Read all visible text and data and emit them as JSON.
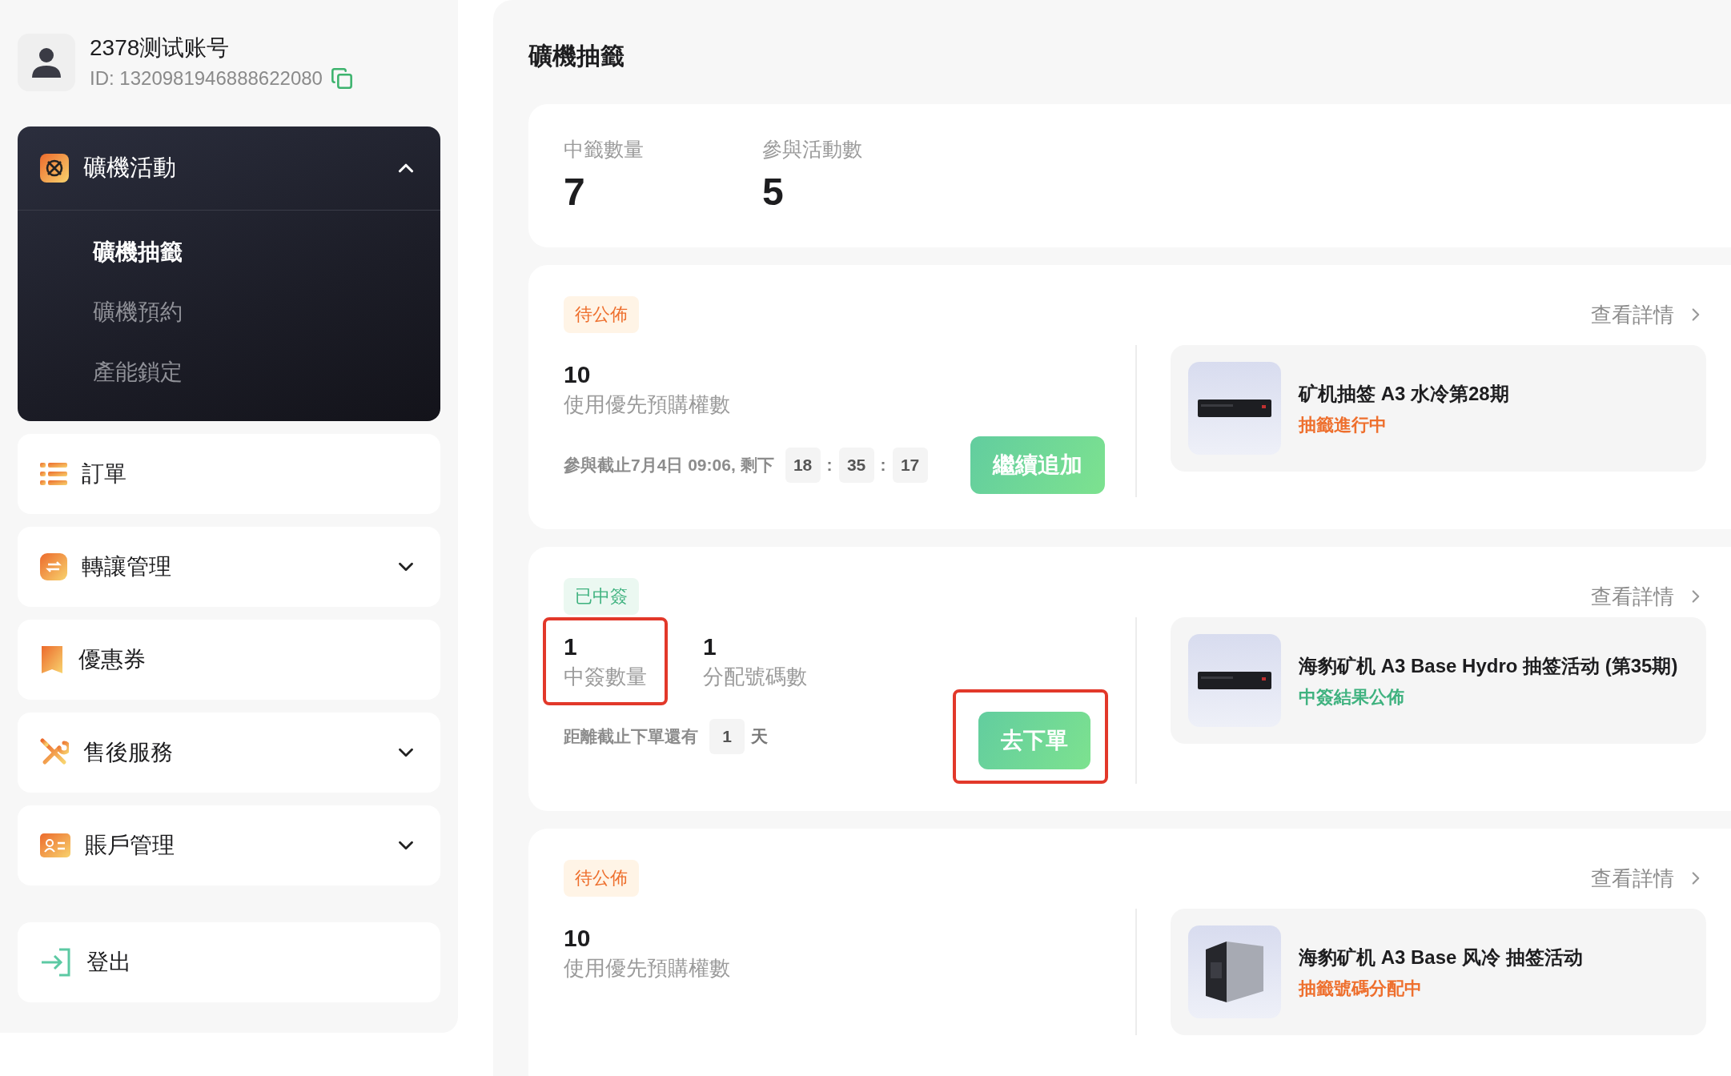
{
  "user": {
    "name": "2378测试账号",
    "id": "ID: 1320981946888622080"
  },
  "sidebar": {
    "items": [
      {
        "label": "礦機活動",
        "expanded": true,
        "children": [
          {
            "label": "礦機抽籤",
            "selected": true
          },
          {
            "label": "礦機預約",
            "selected": false
          },
          {
            "label": "產能鎖定",
            "selected": false
          }
        ]
      },
      {
        "label": "訂單"
      },
      {
        "label": "轉讓管理",
        "expanded": false
      },
      {
        "label": "優惠券"
      },
      {
        "label": "售後服務",
        "expanded": false
      },
      {
        "label": "賬戶管理",
        "expanded": false
      }
    ],
    "logout": "登出"
  },
  "page_title": "礦機抽籤",
  "summary": [
    {
      "label": "中籤數量",
      "value": "7"
    },
    {
      "label": "參與活動數",
      "value": "5"
    }
  ],
  "lotteries": [
    {
      "tag": {
        "label": "待公佈",
        "kind": "pending"
      },
      "detail_link": "查看詳情",
      "stats": [
        {
          "value": "10",
          "label": "使用優先預購權數",
          "highlighted": false
        }
      ],
      "deadline": {
        "text": "參與截止7月4日 09:06, 剩下",
        "segments": [
          {
            "text": "18",
            "kind": "box"
          },
          {
            "text": ":",
            "kind": "plain"
          },
          {
            "text": "35",
            "kind": "box"
          },
          {
            "text": ":",
            "kind": "plain"
          },
          {
            "text": "17",
            "kind": "box"
          }
        ]
      },
      "button": {
        "label": "繼續追加",
        "highlighted": false
      },
      "product": {
        "kind": "rack",
        "title": "矿机抽签 A3 水冷第28期",
        "status": {
          "label": "抽籤進行中",
          "kind": "pending"
        }
      }
    },
    {
      "tag": {
        "label": "已中簽",
        "kind": "won"
      },
      "detail_link": "查看詳情",
      "stats": [
        {
          "value": "1",
          "label": "中簽數量",
          "highlighted": true
        },
        {
          "value": "1",
          "label": "分配號碼數",
          "highlighted": false
        }
      ],
      "deadline": {
        "text": "距離截止下單還有",
        "segments": [
          {
            "text": "1",
            "kind": "box"
          },
          {
            "text": "天",
            "kind": "plain"
          }
        ]
      },
      "button": {
        "label": "去下單",
        "highlighted": true
      },
      "product": {
        "kind": "rack",
        "title": "海豹矿机 A3 Base Hydro 抽签活动 (第35期)",
        "status": {
          "label": "中簽結果公佈",
          "kind": "won"
        }
      }
    },
    {
      "tag": {
        "label": "待公佈",
        "kind": "pending"
      },
      "detail_link": "查看詳情",
      "stats": [
        {
          "value": "10",
          "label": "使用優先預購權數",
          "highlighted": false
        }
      ],
      "product": {
        "kind": "box",
        "title": "海豹矿机 A3 Base 风冷 抽签活动",
        "status": {
          "label": "抽籤號碼分配中",
          "kind": "pending"
        }
      }
    }
  ]
}
